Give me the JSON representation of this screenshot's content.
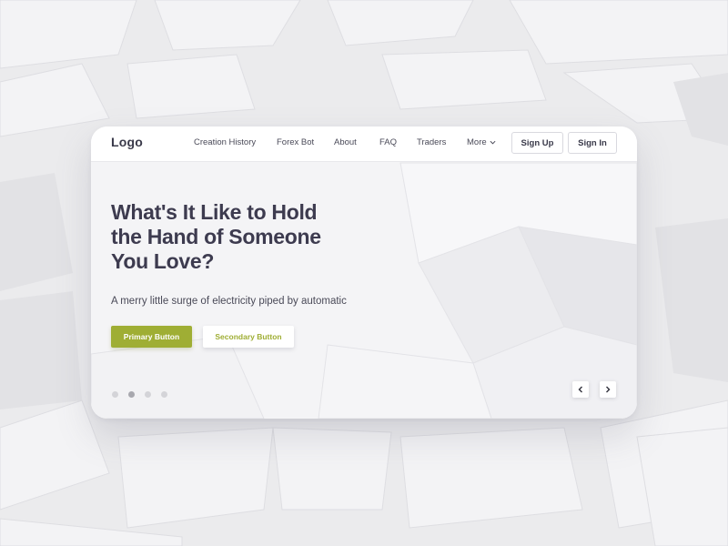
{
  "navbar": {
    "logo": "Logo",
    "items": [
      {
        "label": "Creation History"
      },
      {
        "label": "Forex Bot"
      },
      {
        "label": "About"
      },
      {
        "label": "FAQ"
      },
      {
        "label": "Traders"
      },
      {
        "label": "More"
      }
    ],
    "sign_up": "Sign Up",
    "sign_in": "Sign In"
  },
  "hero": {
    "title_line1": "What's It Like to Hold",
    "title_line2": "the Hand of Someone",
    "title_line3": "You Love?",
    "subtitle": "A merry little surge of electricity piped by automatic",
    "primary_button": "Primary Button",
    "secondary_button": "Secondary Button"
  },
  "carousel": {
    "slide_count": 4,
    "active_slide": 2,
    "prev_icon": "chevron-left-icon",
    "next_icon": "chevron-right-icon"
  },
  "colors": {
    "accent": "#9fae34",
    "text_dark": "#3d3b4f",
    "background": "#e9e9eb"
  }
}
